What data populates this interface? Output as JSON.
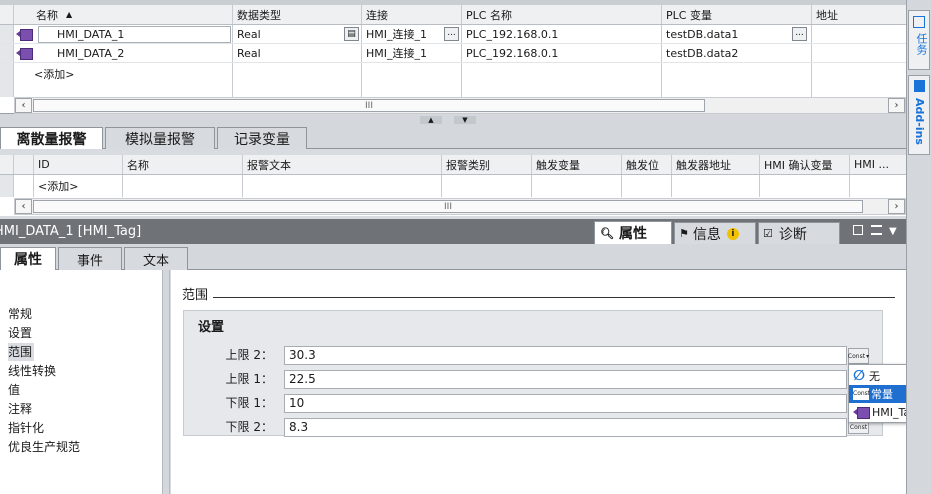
{
  "tag_table": {
    "columns": [
      "名称",
      "数据类型",
      "连接",
      "PLC 名称",
      "PLC 变量",
      "地址"
    ],
    "rows": [
      {
        "name": "HMI_DATA_1",
        "type": "Real",
        "connection": "HMI_连接_1",
        "plc": "PLC_192.168.0.1",
        "variable": "testDB.data1"
      },
      {
        "name": "HMI_DATA_2",
        "type": "Real",
        "connection": "HMI_连接_1",
        "plc": "PLC_192.168.0.1",
        "variable": "testDB.data2"
      }
    ],
    "add_label": "<添加>",
    "scroll_grip": "III"
  },
  "alarm_tabs": [
    "离散量报警",
    "模拟量报警",
    "记录变量"
  ],
  "alarm_table": {
    "columns": [
      "ID",
      "名称",
      "报警文本",
      "报警类别",
      "触发变量",
      "触发位",
      "触发器地址",
      "HMI 确认变量",
      "HMI ..."
    ],
    "add_label": "<添加>",
    "scroll_grip": "III"
  },
  "inspector": {
    "title": "HMI_DATA_1 [HMI_Tag]",
    "tabs": [
      "属性",
      "信息",
      "诊断"
    ],
    "sub_tabs": [
      "属性",
      "事件",
      "文本"
    ],
    "nav": [
      "常规",
      "设置",
      "范围",
      "线性转换",
      "值",
      "注释",
      "指针化",
      "优良生产规范"
    ],
    "selected_nav": "范围",
    "section_title": "范围",
    "group_title": "设置",
    "fields": [
      {
        "label": "上限 2：",
        "value": "30.3"
      },
      {
        "label": "上限 1：",
        "value": "22.5"
      },
      {
        "label": "下限 1：",
        "value": "10"
      },
      {
        "label": "下限 2：",
        "value": "8.3"
      }
    ],
    "const_label": "Const"
  },
  "dropdown": {
    "items": [
      "无",
      "常量",
      "HMI_Tag"
    ],
    "selected": "常量"
  },
  "right_panel": {
    "tasks_label": "任务",
    "addins_label": "Add-ins"
  },
  "colors": {
    "accent": "#1a73d9",
    "selection": "#1f6fd1",
    "tag_icon": "#7b4fb0",
    "title_bar": "#6f7378"
  }
}
